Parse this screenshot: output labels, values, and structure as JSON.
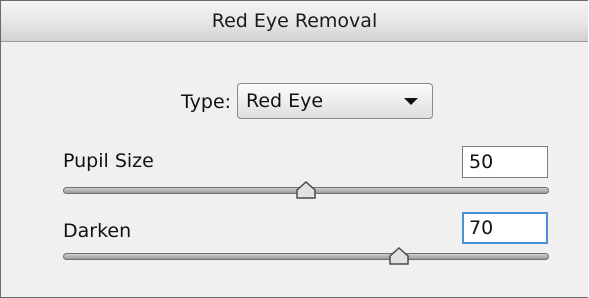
{
  "panel": {
    "title": "Red Eye Removal"
  },
  "type": {
    "label": "Type:",
    "value": "Red Eye"
  },
  "sliders": [
    {
      "label": "Pupil Size",
      "value": "50",
      "position": 0.5
    },
    {
      "label": "Darken",
      "value": "70",
      "position": 0.7
    }
  ],
  "icons": {
    "dropdown": "chevron-down-icon",
    "slider_thumb": "slider-thumb-icon"
  }
}
